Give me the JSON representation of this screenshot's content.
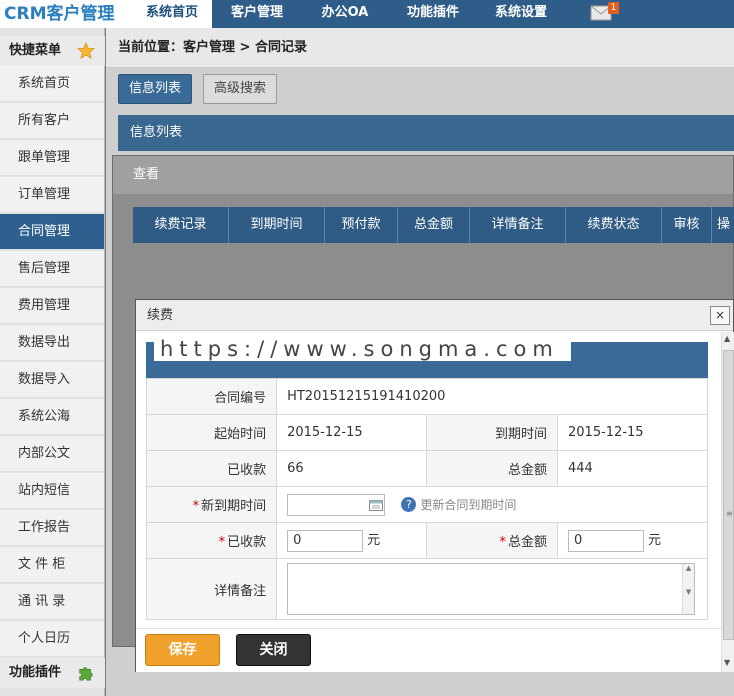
{
  "app": {
    "title": "CRM客户管理"
  },
  "nav": {
    "items": [
      {
        "label": "系统首页",
        "active": true
      },
      {
        "label": "客户管理",
        "active": false
      },
      {
        "label": "办公OA",
        "active": false
      },
      {
        "label": "功能插件",
        "active": false
      },
      {
        "label": "系统设置",
        "active": false
      }
    ],
    "mail_badge": "1"
  },
  "sidebar": {
    "quick_menu_label": "快捷菜单",
    "items": [
      {
        "label": "系统首页"
      },
      {
        "label": "所有客户"
      },
      {
        "label": "跟单管理"
      },
      {
        "label": "订单管理"
      },
      {
        "label": "合同管理",
        "active": true
      },
      {
        "label": "售后管理"
      },
      {
        "label": "费用管理"
      },
      {
        "label": "数据导出"
      },
      {
        "label": "数据导入"
      },
      {
        "label": "系统公海"
      },
      {
        "label": "内部公文"
      },
      {
        "label": "站内短信"
      },
      {
        "label": "工作报告"
      },
      {
        "label": "文 件 柜"
      },
      {
        "label": "通 讯 录"
      },
      {
        "label": "个人日历"
      }
    ],
    "plugins_label": "功能插件"
  },
  "main": {
    "breadcrumb": "当前位置：客户管理 > 合同记录",
    "tabs": [
      {
        "label": "信息列表"
      },
      {
        "label": "高级搜索"
      }
    ],
    "section_title": "信息列表"
  },
  "view_dialog": {
    "title": "查看",
    "columns": [
      "续费记录",
      "到期时间",
      "预付款",
      "总金额",
      "详情备注",
      "续费状态",
      "审核",
      "操"
    ]
  },
  "renew_dialog": {
    "title": "续费",
    "close_label": "×",
    "watermark": "https://www.songma.com",
    "fields": {
      "contract_no_label": "合同编号",
      "contract_no": "HT20151215191410200",
      "start_label": "起始时间",
      "start": "2015-12-15",
      "end_label": "到期时间",
      "end": "2015-12-15",
      "received_label": "已收款",
      "received": "66",
      "total_label": "总金额",
      "total": "444",
      "new_end_label": "新到期时间",
      "new_end_hint": "更新合同到期时间",
      "received_input_label": "已收款",
      "received_input": "0",
      "total_input_label": "总金额",
      "total_input": "0",
      "unit": "元",
      "note_label": "详情备注"
    },
    "buttons": {
      "save": "保存",
      "close": "关闭"
    }
  }
}
